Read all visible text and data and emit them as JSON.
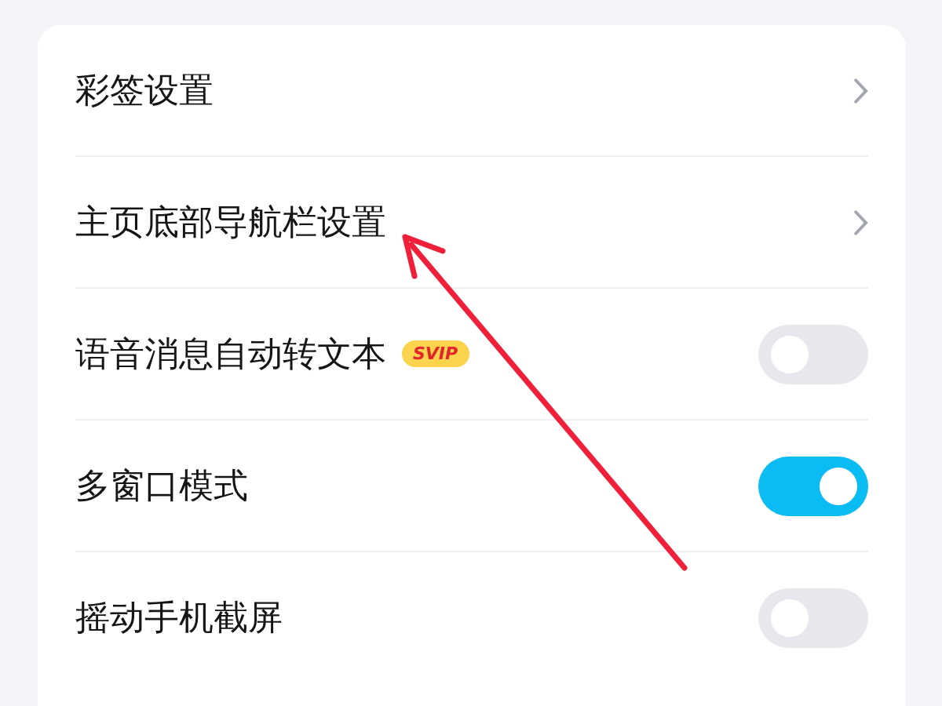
{
  "settings": [
    {
      "kind": "link",
      "label": "彩签设置"
    },
    {
      "kind": "link",
      "label": "主页底部导航栏设置"
    },
    {
      "kind": "toggle",
      "label": "语音消息自动转文本",
      "badge": "SVIP",
      "on": false
    },
    {
      "kind": "toggle",
      "label": "多窗口模式",
      "on": true
    },
    {
      "kind": "toggle",
      "label": "摇动手机截屏",
      "on": false
    }
  ]
}
